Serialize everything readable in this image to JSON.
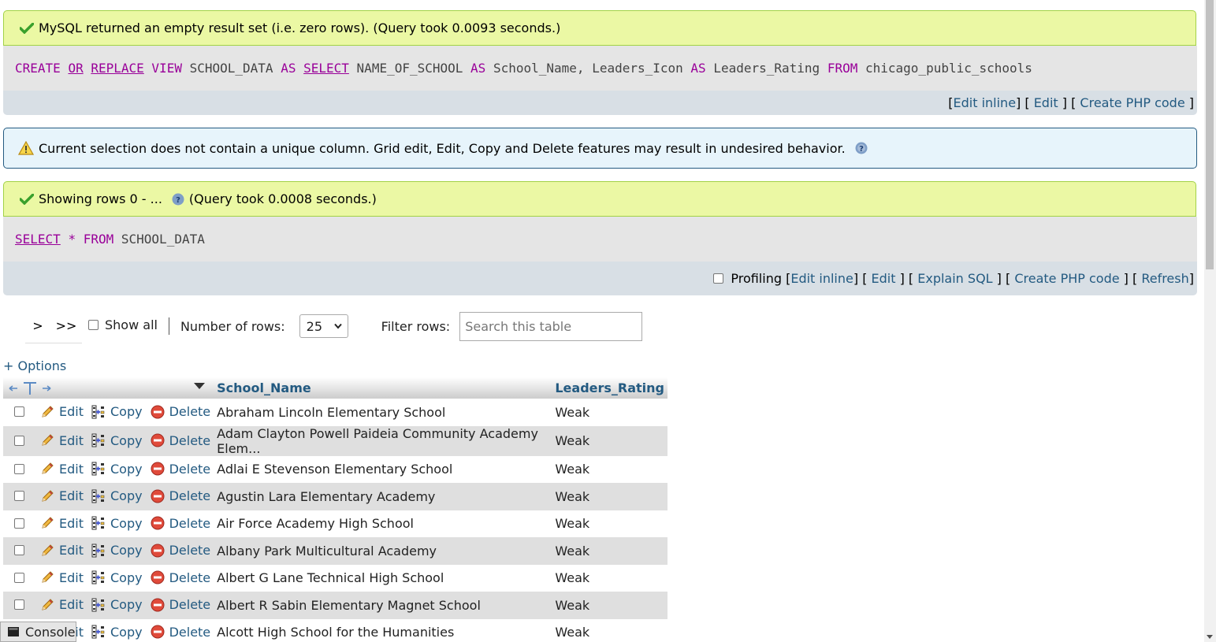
{
  "messages": {
    "empty_result": "MySQL returned an empty result set (i.e. zero rows). (Query took 0.0093 seconds.)",
    "warning": "Current selection does not contain a unique column. Grid edit, Edit, Copy and Delete features may result in undesired behavior.",
    "showing_rows": "Showing rows 0 - ...",
    "query_time": "(Query took 0.0008 seconds.)"
  },
  "query1": {
    "t1": "CREATE",
    "t2": "OR",
    "t3": "REPLACE",
    "t4": "VIEW",
    "t5": "SCHOOL_DATA",
    "t6": "AS",
    "t7": "SELECT",
    "t8": "NAME_OF_SCHOOL",
    "t9": "AS",
    "t10": "School_Name,",
    "t11": "Leaders_Icon",
    "t12": "AS",
    "t13": "Leaders_Rating",
    "t14": "FROM",
    "t15": "chicago_public_schools"
  },
  "query1_tools": {
    "edit_inline": "Edit inline",
    "edit": "Edit",
    "create_php": "Create PHP code"
  },
  "query2": {
    "t1": "SELECT",
    "t2": "*",
    "t3": "FROM",
    "t4": "SCHOOL_DATA"
  },
  "query2_tools": {
    "profiling": "Profiling",
    "edit_inline": "Edit inline",
    "edit": "Edit",
    "explain": "Explain SQL",
    "create_php": "Create PHP code",
    "refresh": "Refresh"
  },
  "navigation": {
    "next": ">",
    "last": ">>",
    "show_all": "Show all",
    "rows_label": "Number of rows:",
    "rows_value": "25",
    "filter_label": "Filter rows:",
    "filter_placeholder": "Search this table"
  },
  "options_link": "+ Options",
  "table": {
    "columns": [
      "School_Name",
      "Leaders_Rating"
    ],
    "actions": {
      "edit": "Edit",
      "copy": "Copy",
      "delete": "Delete"
    },
    "rows": [
      {
        "school": "Abraham Lincoln Elementary School",
        "rating": "Weak"
      },
      {
        "school": "Adam Clayton Powell Paideia Community Academy Elem...",
        "rating": "Weak"
      },
      {
        "school": "Adlai E Stevenson Elementary School",
        "rating": "Weak"
      },
      {
        "school": "Agustin Lara Elementary Academy",
        "rating": "Weak"
      },
      {
        "school": "Air Force Academy High School",
        "rating": "Weak"
      },
      {
        "school": "Albany Park Multicultural Academy",
        "rating": "Weak"
      },
      {
        "school": "Albert G Lane Technical High School",
        "rating": "Weak"
      },
      {
        "school": "Albert R Sabin Elementary Magnet School",
        "rating": "Weak"
      },
      {
        "school": "Alcott High School for the Humanities",
        "rating": "Weak"
      }
    ]
  },
  "console": {
    "label": "Console"
  }
}
